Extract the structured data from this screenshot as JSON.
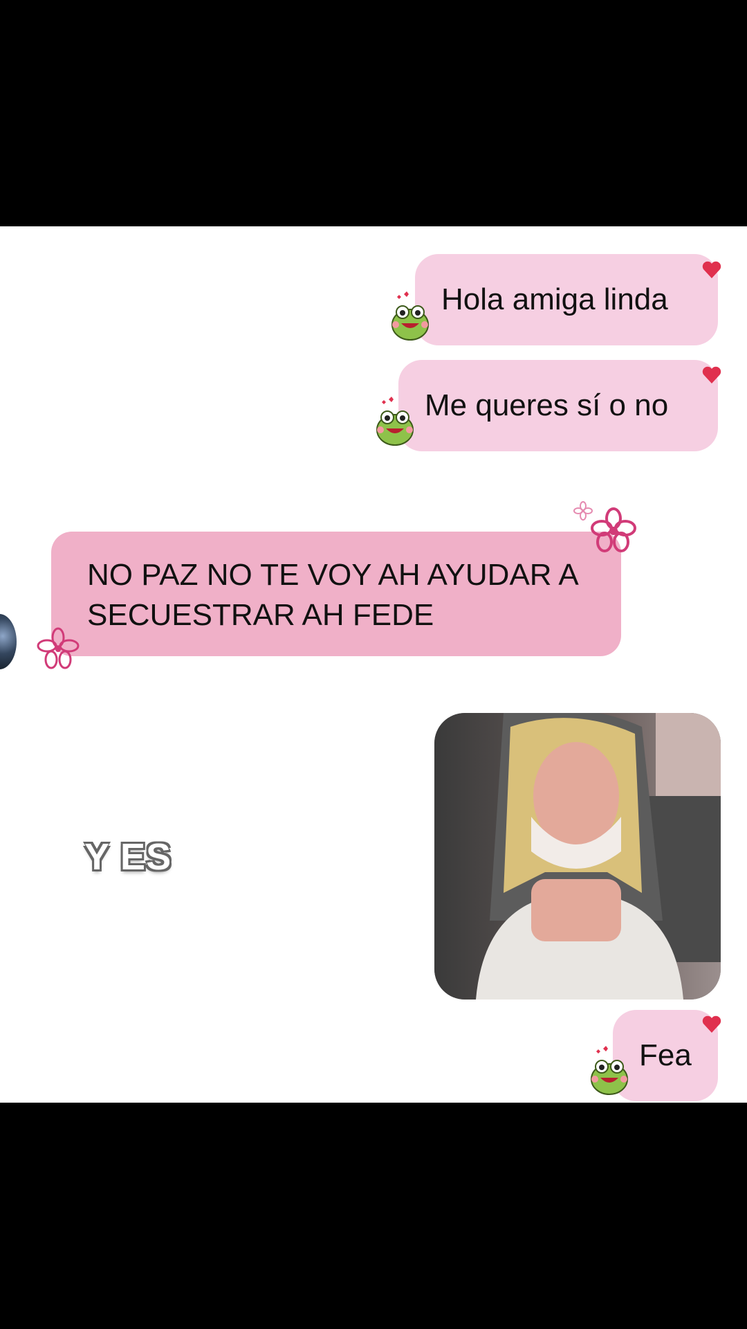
{
  "messages": {
    "out1": "Hola amiga linda",
    "out2": "Me queres sí o no",
    "in1": "NO PAZ NO TE VOY AH AYUDAR A SECUESTRAR AH FEDE",
    "out3": "Fea"
  },
  "overlay_caption": "Y ES",
  "colors": {
    "outgoing_bubble": "#f6cfe2",
    "incoming_bubble": "#f0b0c8",
    "heart": "#e0304e",
    "flower": "#d13b78",
    "frog": "#8ec24a"
  },
  "icons": {
    "sticker": "frog-sticker-icon",
    "reaction": "heart-icon",
    "decoration": "flower-icon",
    "avatar": "contact-avatar"
  }
}
